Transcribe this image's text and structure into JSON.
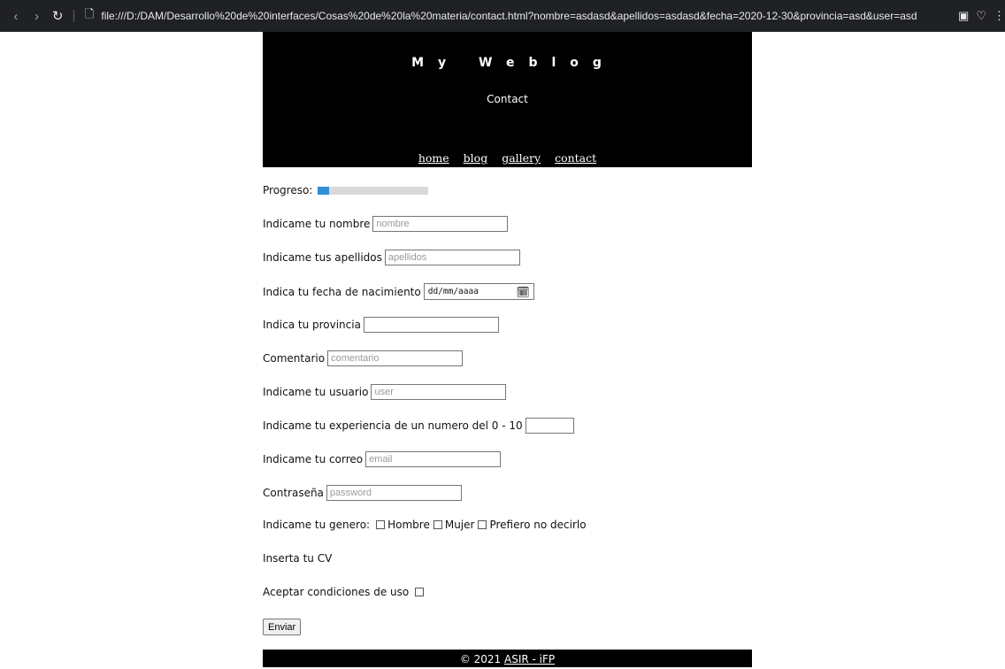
{
  "browser": {
    "url": "file:///D:/DAM/Desarrollo%20de%20interfaces/Cosas%20de%20la%20materia/contact.html?nombre=asdasd&apellidos=asdasd&fecha=2020-12-30&provincia=asd&user=asd",
    "icons": [
      "back-icon",
      "forward-icon",
      "reload-icon",
      "page-icon",
      "screenshot-icon",
      "heart-icon",
      "menu-icon"
    ]
  },
  "header": {
    "title": "My Weblog",
    "subtitle": "Contact",
    "nav": [
      "home",
      "blog",
      "gallery",
      "contact"
    ]
  },
  "form": {
    "progress_label": "Progreso:",
    "progress_value": 0.1,
    "nombre_label": "Indicame tu nombre",
    "nombre_placeholder": "nombre",
    "apellidos_label": "Indicame tus apellidos",
    "apellidos_placeholder": "apellidos",
    "fecha_label": "Indica tu fecha de nacimiento",
    "fecha_placeholder": "dd/mm/aaaa",
    "provincia_label": "Indica tu provincia",
    "comentario_label": "Comentario",
    "comentario_placeholder": "comentario",
    "usuario_label": "Indicame tu usuario",
    "usuario_placeholder": "user",
    "experiencia_label": "Indicame tu experiencia de un numero del 0 - 10",
    "correo_label": "Indicame tu correo",
    "correo_placeholder": "email",
    "password_label": "Contraseña",
    "password_placeholder": "password",
    "genero_label": "Indicame tu genero:",
    "genero_options": [
      "Hombre",
      "Mujer",
      "Prefiero no decirlo"
    ],
    "cv_label": "Inserta tu CV",
    "condiciones_label": "Aceptar condiciones de uso",
    "submit_label": "Enviar"
  },
  "footer": {
    "copyright": "© 2021",
    "link": "ASIR - iFP"
  }
}
